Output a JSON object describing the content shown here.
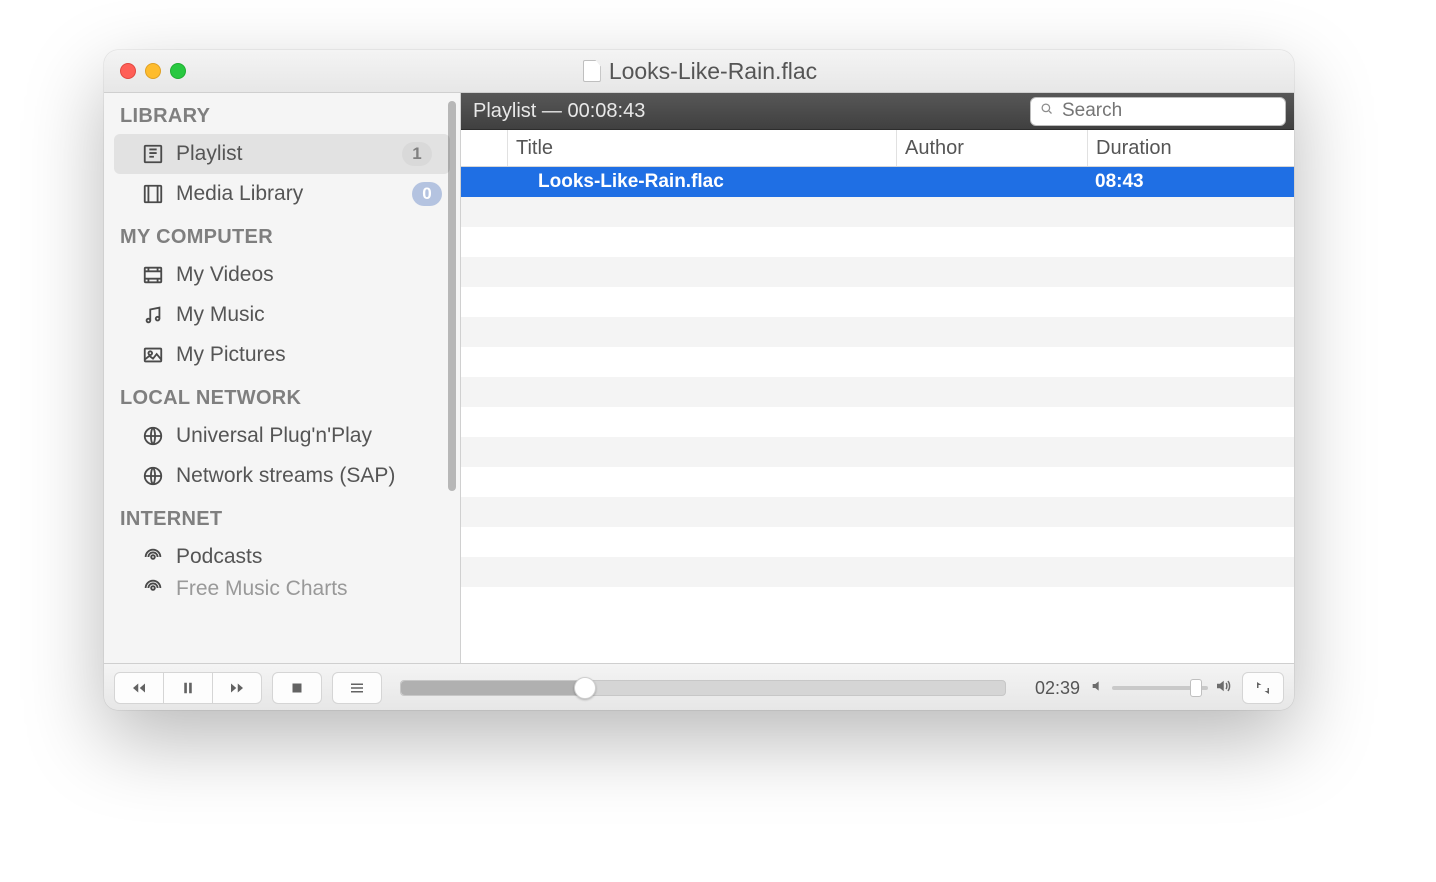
{
  "window": {
    "title": "Looks-Like-Rain.flac"
  },
  "sidebar": {
    "sections": [
      {
        "title": "LIBRARY",
        "items": [
          {
            "label": "Playlist",
            "badge": "1"
          },
          {
            "label": "Media Library",
            "badge": "0"
          }
        ]
      },
      {
        "title": "MY COMPUTER",
        "items": [
          {
            "label": "My Videos"
          },
          {
            "label": "My Music"
          },
          {
            "label": "My Pictures"
          }
        ]
      },
      {
        "title": "LOCAL NETWORK",
        "items": [
          {
            "label": "Universal Plug'n'Play"
          },
          {
            "label": "Network streams (SAP)"
          }
        ]
      },
      {
        "title": "INTERNET",
        "items": [
          {
            "label": "Podcasts"
          },
          {
            "label": "Free Music Charts"
          }
        ]
      }
    ]
  },
  "playlist": {
    "header": "Playlist — 00:08:43",
    "search_placeholder": "Search",
    "columns": [
      "Title",
      "Author",
      "Duration"
    ],
    "rows": [
      {
        "title": "Looks-Like-Rain.flac",
        "author": "",
        "duration": "08:43"
      }
    ]
  },
  "player": {
    "elapsed": "02:39",
    "total": "08:43",
    "progress_percent": 30.4,
    "volume_percent": 88
  }
}
